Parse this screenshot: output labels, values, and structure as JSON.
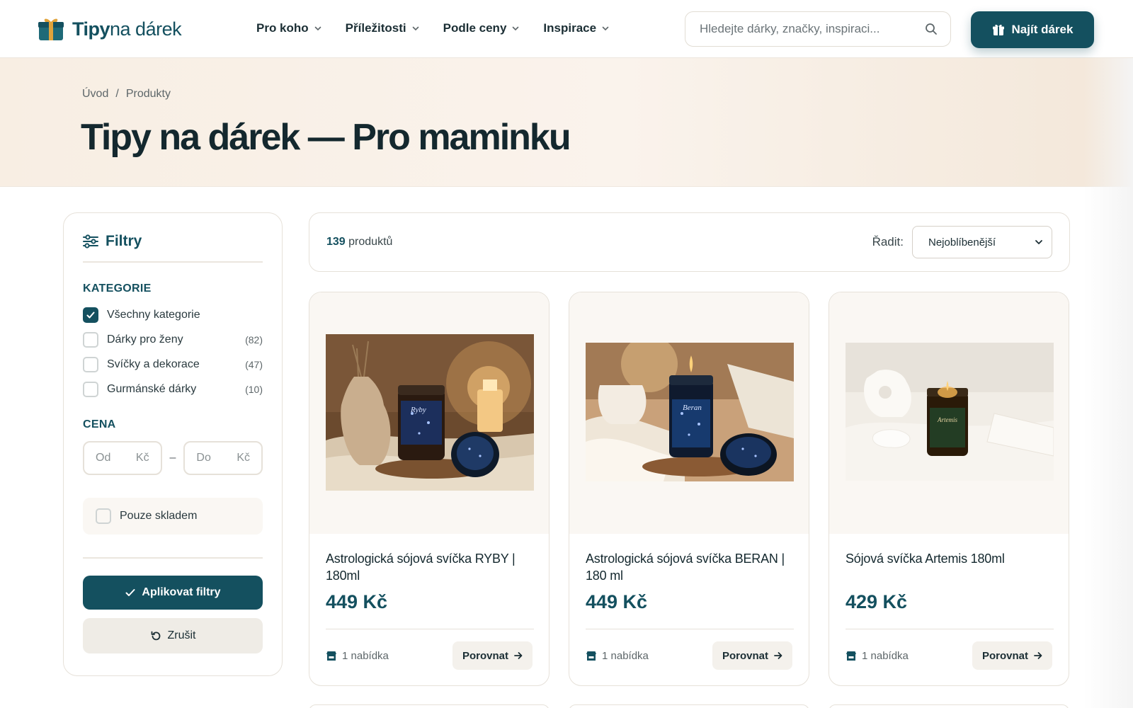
{
  "header": {
    "logo_bold": "Tipy",
    "logo_light": "na dárek",
    "nav": [
      {
        "label": "Pro koho"
      },
      {
        "label": "Příležitosti"
      },
      {
        "label": "Podle ceny"
      },
      {
        "label": "Inspirace"
      }
    ],
    "search_placeholder": "Hledejte dárky, značky, inspiraci...",
    "cta_label": "Najít dárek"
  },
  "hero": {
    "breadcrumb": [
      "Úvod",
      "/",
      "Produkty"
    ],
    "title": "Tipy na dárek — Pro maminku"
  },
  "filters": {
    "title": "Filtry",
    "category_title": "KATEGORIE",
    "categories": [
      {
        "label": "Všechny kategorie",
        "count": "",
        "checked": true
      },
      {
        "label": "Dárky pro ženy",
        "count": "(82)",
        "checked": false
      },
      {
        "label": "Svíčky a dekorace",
        "count": "(47)",
        "checked": false
      },
      {
        "label": "Gurmánské dárky",
        "count": "(10)",
        "checked": false
      }
    ],
    "price_title": "CENA",
    "price_from_placeholder": "Od",
    "price_to_placeholder": "Do",
    "currency": "Kč",
    "price_dash": "–",
    "in_stock_label": "Pouze skladem",
    "apply_label": "Aplikovat filtry",
    "reset_label": "Zrušit"
  },
  "toolbar": {
    "count_number": "139",
    "count_label": "produktů",
    "sort_label": "Řadit:",
    "sort_value": "Nejoblíbenější"
  },
  "products": [
    {
      "title": "Astrologická sójová svíčka RYBY | 180ml",
      "price": "449 Kč",
      "offers": "1 nabídka",
      "compare": "Porovnat",
      "jar_label": "Ryby"
    },
    {
      "title": "Astrologická sójová svíčka BERAN | 180 ml",
      "price": "449 Kč",
      "offers": "1 nabídka",
      "compare": "Porovnat",
      "jar_label": "Beran"
    },
    {
      "title": "Sójová svíčka Artemis 180ml",
      "price": "429 Kč",
      "offers": "1 nabídka",
      "compare": "Porovnat",
      "jar_label": "Artemis"
    }
  ],
  "colors": {
    "primary": "#14505f",
    "hero_bg": "#f8eee3",
    "card_media_bg": "#faf7f3",
    "border": "#e6e1d9"
  },
  "icons": [
    "gift-logo-icon",
    "chevron-down-icon",
    "search-icon",
    "gift-icon",
    "filter-sliders-icon",
    "check-icon",
    "reset-icon",
    "store-icon",
    "arrow-right-icon"
  ]
}
